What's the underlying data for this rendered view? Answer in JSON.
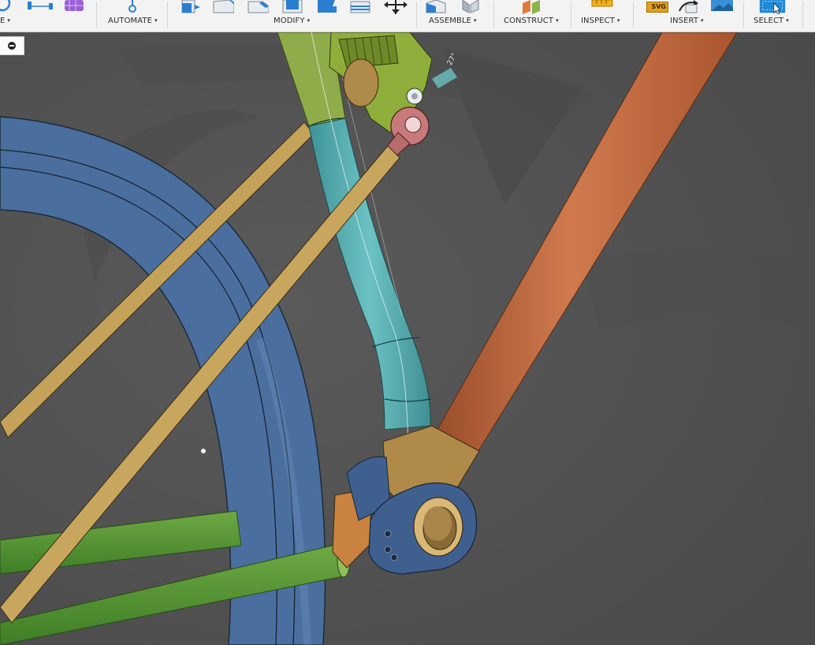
{
  "toolbar": {
    "groups": [
      {
        "id": "create",
        "label": "E",
        "menu": true
      },
      {
        "id": "automate",
        "label": "AUTOMATE",
        "menu": true
      },
      {
        "id": "modify",
        "label": "MODIFY",
        "menu": true
      },
      {
        "id": "assemble",
        "label": "ASSEMBLE",
        "menu": true
      },
      {
        "id": "construct",
        "label": "CONSTRUCT",
        "menu": true
      },
      {
        "id": "inspect",
        "label": "INSPECT",
        "menu": true
      },
      {
        "id": "insert",
        "label": "INSERT",
        "menu": true
      },
      {
        "id": "select",
        "label": "SELECT",
        "menu": true
      }
    ],
    "caret": "▾",
    "svg_badge": "SVG"
  },
  "viewport": {
    "angle_annotation": "27°",
    "colors": {
      "background": "#555555",
      "wheel_blue": "#4a6f9f",
      "seat_tube_green": "#8fac4a",
      "down_tube_teal": "#4fa9ad",
      "top_tube_orange": "#c06a42",
      "rod_tan": "#c4a25a",
      "chainstay_green": "#5f9a3a",
      "dropout_blue": "#3f5f8f",
      "bushing_gold": "#b08a48"
    }
  },
  "panel": {
    "collapse_icon": "minus-circle-icon"
  }
}
